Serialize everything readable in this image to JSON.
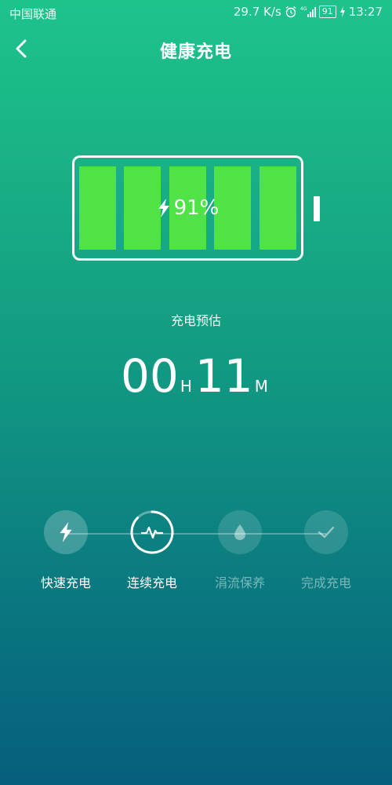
{
  "status_bar": {
    "carrier": "中国联通",
    "speed": "29.7 K/s",
    "network": "4G",
    "battery": "91",
    "time": "13:27"
  },
  "header": {
    "title": "健康充电"
  },
  "battery": {
    "percent_label": "91%",
    "cell_color": "#4fe347"
  },
  "estimate": {
    "label": "充电预估",
    "hours": "00",
    "hours_unit": "H",
    "minutes": "11",
    "minutes_unit": "M"
  },
  "steps": [
    {
      "label": "快速充电",
      "icon": "lightning-icon",
      "state": "done"
    },
    {
      "label": "连续充电",
      "icon": "pulse-icon",
      "state": "current"
    },
    {
      "label": "涓流保养",
      "icon": "droplet-icon",
      "state": "pending"
    },
    {
      "label": "完成充电",
      "icon": "check-icon",
      "state": "pending"
    }
  ]
}
